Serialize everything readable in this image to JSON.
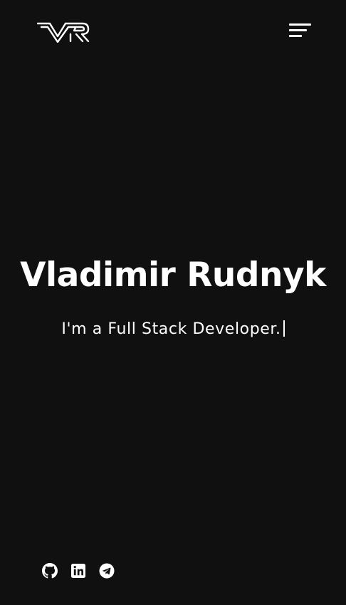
{
  "header": {
    "logo_icon": "vr-monogram-logo",
    "menu_icon": "hamburger-menu-icon"
  },
  "hero": {
    "title": "Vladimir Rudnyk",
    "subtitle": "I'm a Full Stack Developer."
  },
  "socials": [
    {
      "icon": "github-icon"
    },
    {
      "icon": "linkedin-icon"
    },
    {
      "icon": "telegram-icon"
    }
  ],
  "colors": {
    "background": "#101010",
    "foreground": "#ffffff"
  }
}
